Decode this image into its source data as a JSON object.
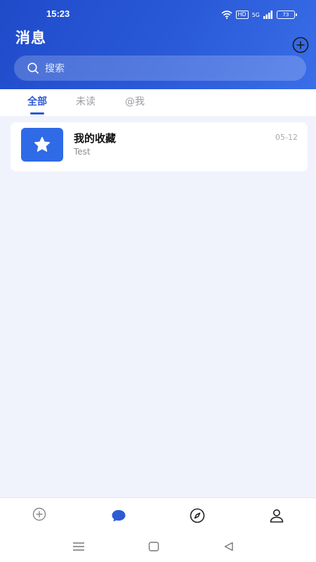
{
  "status_bar": {
    "time": "15:23",
    "hd": "HD",
    "signal": "5G",
    "battery": "73"
  },
  "header": {
    "title": "消息",
    "search_placeholder": "搜索"
  },
  "tabs": [
    {
      "label": "全部",
      "active": true
    },
    {
      "label": "未读",
      "active": false
    },
    {
      "label": "@我",
      "active": false
    }
  ],
  "conversations": [
    {
      "title": "我的收藏",
      "subtitle": "Test",
      "date": "05-12",
      "icon": "star-icon"
    }
  ],
  "bottom_nav": [
    {
      "icon": "plus-circle-icon",
      "active": false
    },
    {
      "icon": "chat-bubble-icon",
      "active": true
    },
    {
      "icon": "compass-icon",
      "active": false
    },
    {
      "icon": "user-icon",
      "active": false
    }
  ],
  "colors": {
    "accent": "#2c5bd4",
    "header_start": "#1f4bc9",
    "header_end": "#3a6ee8",
    "content_bg": "#f0f3fc"
  }
}
